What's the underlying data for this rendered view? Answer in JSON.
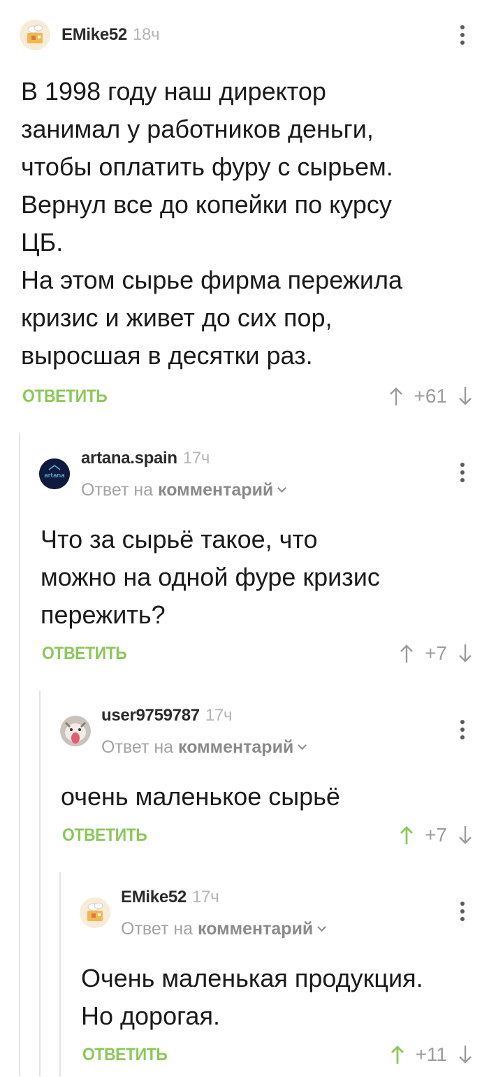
{
  "comments": [
    {
      "author": "EMike52",
      "time": "18ч",
      "reply_prefix": "",
      "reply_target": "",
      "lines": [
        "В 1998 году наш директор",
        "занимал у работников деньги,",
        "чтобы оплатить фуру с сырьем.",
        "Вернул все до копейки по курсу",
        "ЦБ.",
        "На этом сырье фирма пережила",
        "кризис и живет до сих пор,",
        "выросшая в десятки раз."
      ],
      "reply_label": "ОТВЕТИТЬ",
      "score": "+61",
      "upvoted": false
    },
    {
      "author": "artana.spain",
      "time": "17ч",
      "avatar_text": "artana",
      "reply_prefix": "Ответ на",
      "reply_target": "комментарий",
      "lines": [
        "Что за сырьё такое, что",
        "можно на одной фуре кризис",
        "пережить?"
      ],
      "reply_label": "ОТВЕТИТЬ",
      "score": "+7",
      "upvoted": false
    },
    {
      "author": "user9759787",
      "time": "17ч",
      "reply_prefix": "Ответ на",
      "reply_target": "комментарий",
      "lines": [
        "очень маленькое сырьё"
      ],
      "reply_label": "ОТВЕТИТЬ",
      "score": "+7",
      "upvoted": true
    },
    {
      "author": "EMike52",
      "time": "17ч",
      "reply_prefix": "Ответ на",
      "reply_target": "комментарий",
      "lines": [
        "Очень маленькая продукция.",
        "Но дорогая."
      ],
      "reply_label": "ОТВЕТИТЬ",
      "score": "+11",
      "upvoted": true
    }
  ],
  "colors": {
    "accent_green": "#8ac858",
    "muted_text": "#a3a3a3",
    "arrow_gray": "#9c9c9c",
    "thread_line": "#e3e3e3"
  },
  "icons": {
    "upvote": "arrow-up-icon",
    "downvote": "arrow-down-icon",
    "menu": "more-vertical-icon"
  }
}
